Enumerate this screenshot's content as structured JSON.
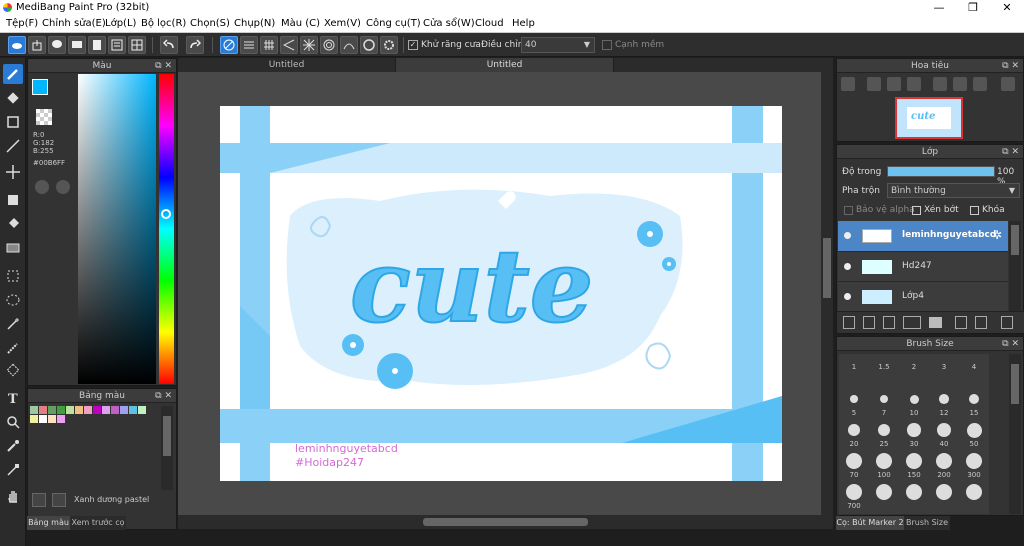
{
  "window": {
    "title": "MediBang Paint Pro (32bit)",
    "minimize": "—",
    "maximize": "❐",
    "close": "✕"
  },
  "menu": [
    "Tệp(F)",
    "Chỉnh sửa(E)",
    "Lớp(L)",
    "Bộ lọc(R)",
    "Chọn(S)",
    "Chụp(N)",
    "Màu (C)",
    "Xem(V)",
    "Công cụ(T)",
    "Cửa sổ(W)",
    "Cloud",
    "Help"
  ],
  "toolbar": {
    "antialias_label": "Khử răng cưa",
    "adjust_label": "Điều chỉnh",
    "adjust_value": "40",
    "smooth_edge_label": "Cạnh mềm",
    "antialias_checked": true,
    "smooth_edge_checked": false
  },
  "color_panel": {
    "title": "Màu",
    "r": "R:0",
    "g": "G:182",
    "b": "B:255",
    "hex": "#00B6FF",
    "primary_color": "#00B6FF"
  },
  "palette_panel": {
    "title": "Bảng màu",
    "selected_name": "Xanh dương pastel",
    "colors": [
      "#a0c8a0",
      "#e08080",
      "#60a060",
      "#40a040",
      "#c0e0a0",
      "#f0c080",
      "#f0a0c0",
      "#c000c0",
      "#e0a0f0",
      "#c060c0",
      "#a0a0f0",
      "#60c0e0",
      "#c0f0c0",
      "#f0f0a0",
      "#ffffff",
      "#ffe0c0",
      "#f0a0f0"
    ],
    "tabs": [
      "Bảng màu",
      "Xem trước cọ"
    ]
  },
  "doc_tabs": [
    "Untitled",
    "Untitled"
  ],
  "artwork": {
    "word": "cute",
    "watermark_line1": "leminhnguyetabcd",
    "watermark_line2": "#Hoidap247"
  },
  "navigator_panel": {
    "title": "Hoa tiêu"
  },
  "layer_panel": {
    "title": "Lớp",
    "opacity_label": "Độ trong",
    "opacity_value": "100 %",
    "opacity_fraction": 1.0,
    "blend_label": "Pha trộn",
    "blend_value": "Bình thường",
    "protect_alpha_label": "Bảo vệ alpha",
    "clip_label": "Xén bớt",
    "lock_label": "Khóa",
    "layers": [
      {
        "name": "leminhnguyetabcd",
        "selected": true
      },
      {
        "name": "Hd247",
        "selected": false
      },
      {
        "name": "Lớp4",
        "selected": false
      }
    ]
  },
  "brush_size_panel": {
    "title": "Brush Size",
    "sizes": [
      "1",
      "1.5",
      "2",
      "3",
      "4",
      "5",
      "7",
      "10",
      "12",
      "15",
      "20",
      "25",
      "30",
      "40",
      "50",
      "70",
      "100",
      "150",
      "200",
      "300",
      "700",
      "",
      "",
      "",
      ""
    ],
    "tabs": [
      "Cọ: Bút Marker 2",
      "Brush Size"
    ]
  }
}
